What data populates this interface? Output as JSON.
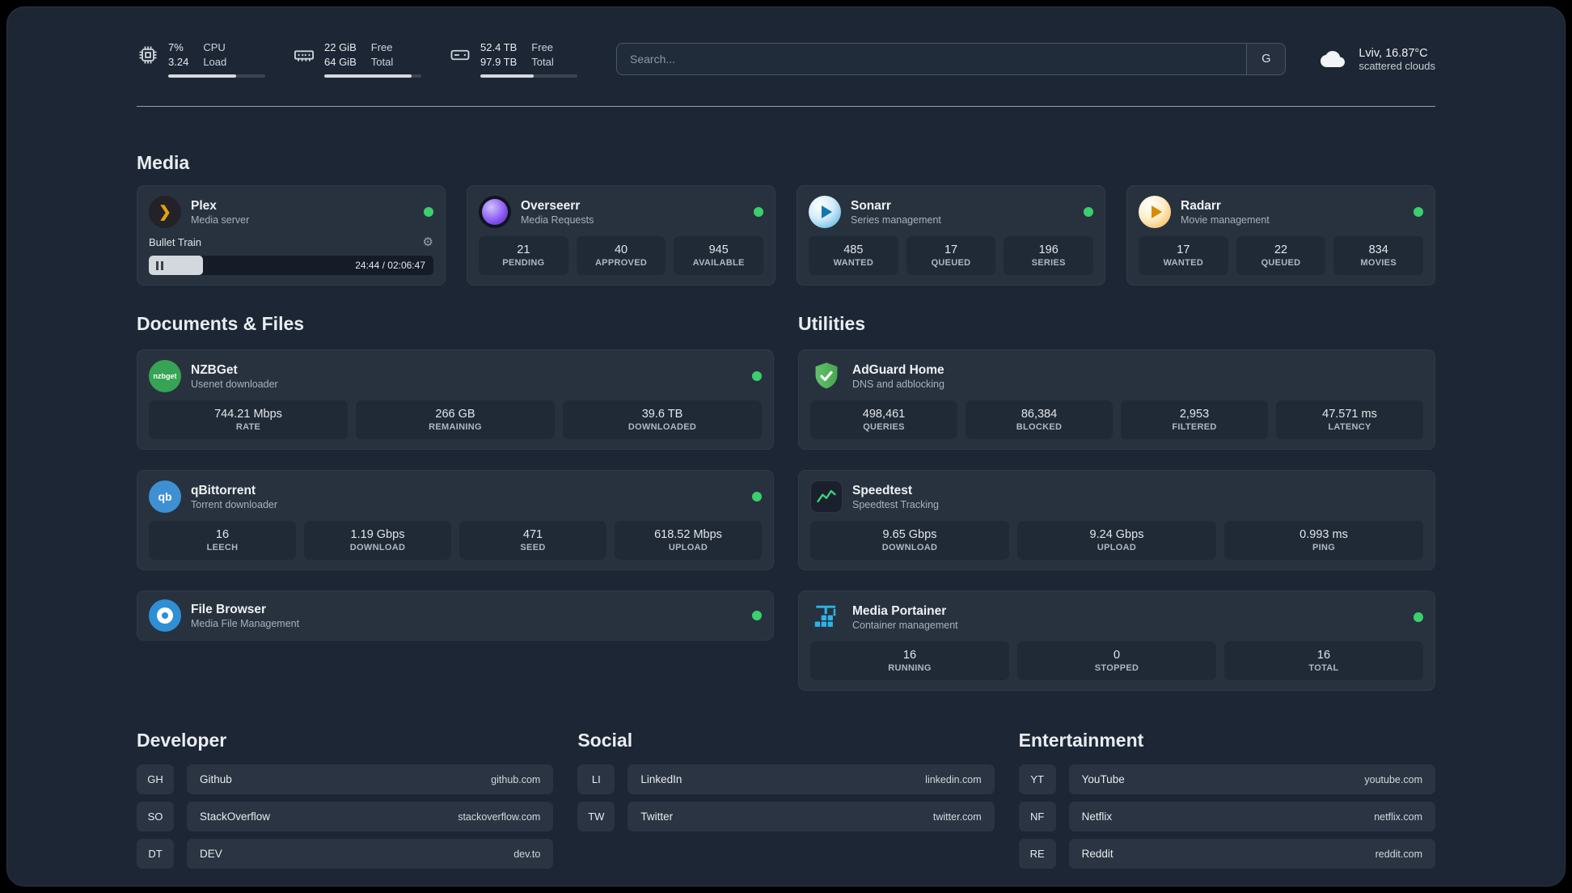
{
  "topbar": {
    "cpu": {
      "value_top": "7%",
      "value_bottom": "3.24",
      "label_top": "CPU",
      "label_bottom": "Load"
    },
    "ram": {
      "value_top": "22 GiB",
      "value_bottom": "64 GiB",
      "label_top": "Free",
      "label_bottom": "Total"
    },
    "disk": {
      "value_top": "52.4 TB",
      "value_bottom": "97.9 TB",
      "label_top": "Free",
      "label_bottom": "Total"
    },
    "search": {
      "placeholder": "Search...",
      "button_label": "G"
    },
    "weather": {
      "location": "Lviv, 16.87°C",
      "condition": "scattered clouds"
    }
  },
  "media": {
    "title": "Media",
    "plex": {
      "title": "Plex",
      "subtitle": "Media server",
      "now_playing": "Bullet Train",
      "time": "24:44 / 02:06:47"
    },
    "overseerr": {
      "title": "Overseerr",
      "subtitle": "Media Requests",
      "stats": [
        {
          "value": "21",
          "label": "PENDING"
        },
        {
          "value": "40",
          "label": "APPROVED"
        },
        {
          "value": "945",
          "label": "AVAILABLE"
        }
      ]
    },
    "sonarr": {
      "title": "Sonarr",
      "subtitle": "Series management",
      "stats": [
        {
          "value": "485",
          "label": "WANTED"
        },
        {
          "value": "17",
          "label": "QUEUED"
        },
        {
          "value": "196",
          "label": "SERIES"
        }
      ]
    },
    "radarr": {
      "title": "Radarr",
      "subtitle": "Movie management",
      "stats": [
        {
          "value": "17",
          "label": "WANTED"
        },
        {
          "value": "22",
          "label": "QUEUED"
        },
        {
          "value": "834",
          "label": "MOVIES"
        }
      ]
    }
  },
  "documents": {
    "title": "Documents & Files",
    "nzbget": {
      "title": "NZBGet",
      "subtitle": "Usenet downloader",
      "icon_text": "nzbget",
      "stats": [
        {
          "value": "744.21 Mbps",
          "label": "RATE"
        },
        {
          "value": "266 GB",
          "label": "REMAINING"
        },
        {
          "value": "39.6 TB",
          "label": "DOWNLOADED"
        }
      ]
    },
    "qbittorrent": {
      "title": "qBittorrent",
      "subtitle": "Torrent downloader",
      "icon_text": "qb",
      "stats": [
        {
          "value": "16",
          "label": "LEECH"
        },
        {
          "value": "1.19 Gbps",
          "label": "DOWNLOAD"
        },
        {
          "value": "471",
          "label": "SEED"
        },
        {
          "value": "618.52 Mbps",
          "label": "UPLOAD"
        }
      ]
    },
    "filebrowser": {
      "title": "File Browser",
      "subtitle": "Media File Management"
    }
  },
  "utilities": {
    "title": "Utilities",
    "adguard": {
      "title": "AdGuard Home",
      "subtitle": "DNS and adblocking",
      "stats": [
        {
          "value": "498,461",
          "label": "QUERIES"
        },
        {
          "value": "86,384",
          "label": "BLOCKED"
        },
        {
          "value": "2,953",
          "label": "FILTERED"
        },
        {
          "value": "47.571 ms",
          "label": "LATENCY"
        }
      ]
    },
    "speedtest": {
      "title": "Speedtest",
      "subtitle": "Speedtest Tracking",
      "stats": [
        {
          "value": "9.65 Gbps",
          "label": "DOWNLOAD"
        },
        {
          "value": "9.24 Gbps",
          "label": "UPLOAD"
        },
        {
          "value": "0.993 ms",
          "label": "PING"
        }
      ]
    },
    "portainer": {
      "title": "Media Portainer",
      "subtitle": "Container management",
      "stats": [
        {
          "value": "16",
          "label": "RUNNING"
        },
        {
          "value": "0",
          "label": "STOPPED"
        },
        {
          "value": "16",
          "label": "TOTAL"
        }
      ]
    }
  },
  "bookmarks": {
    "developer": {
      "title": "Developer",
      "items": [
        {
          "abbr": "GH",
          "name": "Github",
          "url": "github.com"
        },
        {
          "abbr": "SO",
          "name": "StackOverflow",
          "url": "stackoverflow.com"
        },
        {
          "abbr": "DT",
          "name": "DEV",
          "url": "dev.to"
        }
      ]
    },
    "social": {
      "title": "Social",
      "items": [
        {
          "abbr": "LI",
          "name": "LinkedIn",
          "url": "linkedin.com"
        },
        {
          "abbr": "TW",
          "name": "Twitter",
          "url": "twitter.com"
        }
      ]
    },
    "entertainment": {
      "title": "Entertainment",
      "items": [
        {
          "abbr": "YT",
          "name": "YouTube",
          "url": "youtube.com"
        },
        {
          "abbr": "NF",
          "name": "Netflix",
          "url": "netflix.com"
        },
        {
          "abbr": "RE",
          "name": "Reddit",
          "url": "reddit.com"
        }
      ]
    }
  }
}
